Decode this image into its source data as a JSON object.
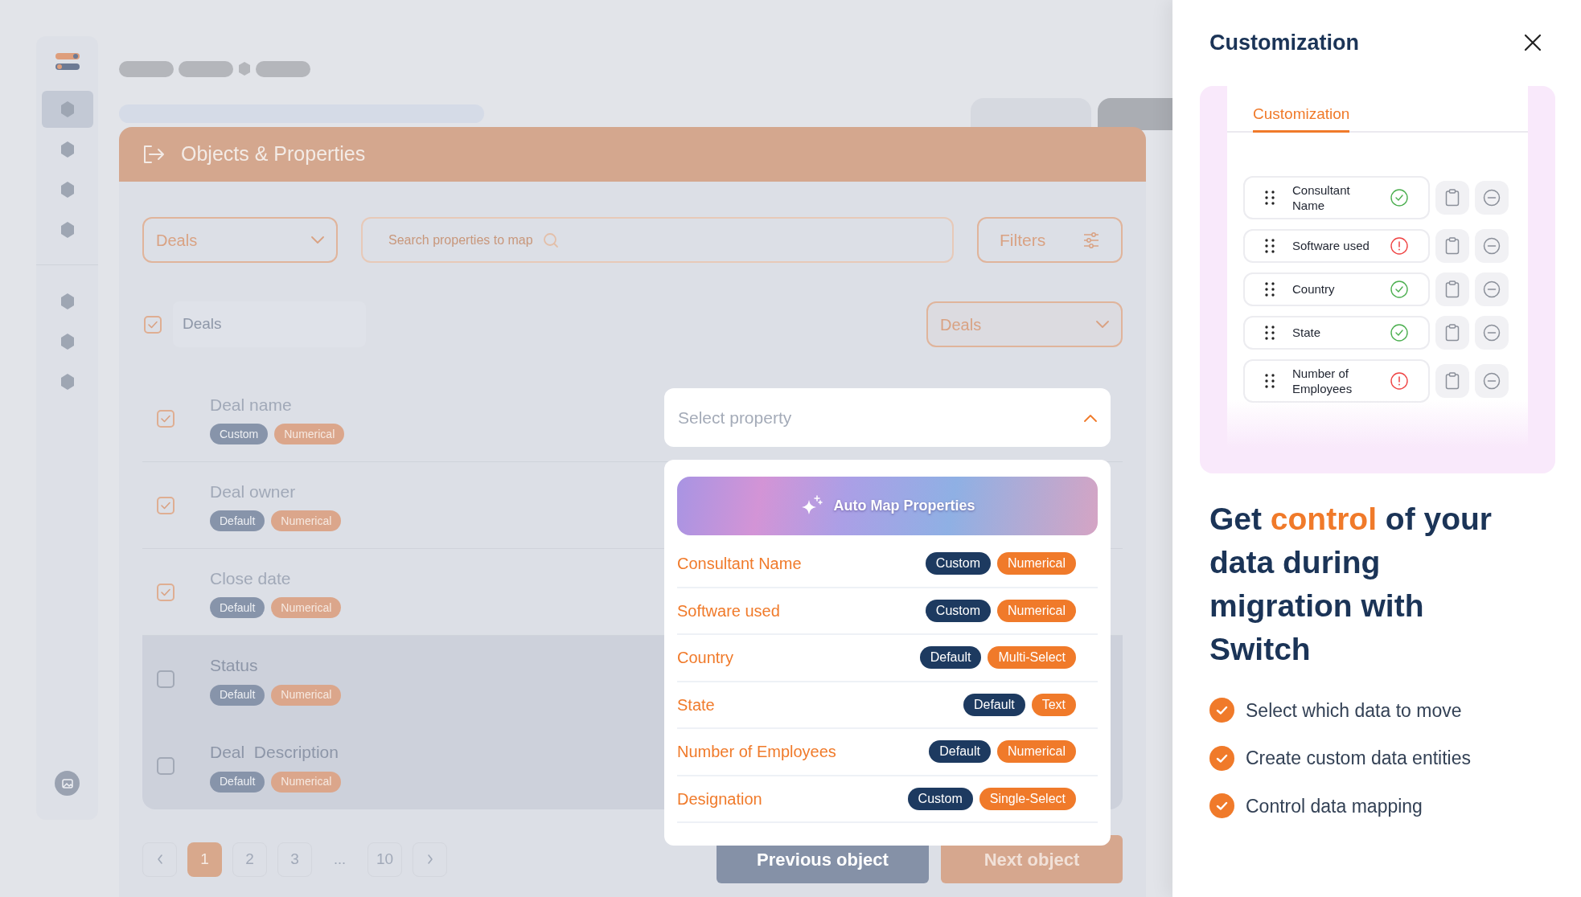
{
  "sidebar": {
    "top_items": [
      {
        "selected": true
      },
      {
        "selected": false
      },
      {
        "selected": false
      },
      {
        "selected": false
      }
    ],
    "bottom_items": [
      {
        "selected": false
      },
      {
        "selected": false
      },
      {
        "selected": false
      }
    ]
  },
  "main": {
    "title": "Objects & Properties",
    "object_select": {
      "value": "Deals"
    },
    "search": {
      "placeholder": "Search properties to map"
    },
    "filters_button": "Filters",
    "select_all": {
      "label": "Deals",
      "checked": true
    },
    "target_select": {
      "value": "Deals"
    }
  },
  "properties": [
    {
      "name": "Deal name",
      "checked": true,
      "source": "Custom",
      "type": "Numerical"
    },
    {
      "name": "Deal owner",
      "checked": true,
      "source": "Default",
      "type": "Numerical"
    },
    {
      "name": "Close date",
      "checked": true,
      "source": "Default",
      "type": "Numerical"
    },
    {
      "name": "Status",
      "checked": false,
      "source": "Default",
      "type": "Numerical"
    },
    {
      "name": "Deal  Description",
      "checked": false,
      "source": "Default",
      "type": "Numerical"
    }
  ],
  "property_dropdown": {
    "placeholder": "Select property",
    "expanded": true,
    "auto_map_button": "Auto Map Properties",
    "options": [
      {
        "name": "Consultant Name",
        "source": "Custom",
        "type": "Numerical"
      },
      {
        "name": "Software used",
        "source": "Custom",
        "type": "Numerical"
      },
      {
        "name": "Country",
        "source": "Default",
        "type": "Multi-Select"
      },
      {
        "name": "State",
        "source": "Default",
        "type": "Text"
      },
      {
        "name": "Number of Employees",
        "source": "Default",
        "type": "Numerical"
      },
      {
        "name": "Designation",
        "source": "Custom",
        "type": "Single-Select"
      }
    ]
  },
  "pagination": [
    {
      "label": "1",
      "kind": "page",
      "selected": true
    },
    {
      "label": "2",
      "kind": "page",
      "selected": false
    },
    {
      "label": "3",
      "kind": "page",
      "selected": false
    },
    {
      "label": "...",
      "kind": "ellipsis"
    },
    {
      "label": "10",
      "kind": "page",
      "selected": false
    }
  ],
  "buttons": {
    "previous": "Previous object",
    "next": "Next object"
  },
  "panel": {
    "title": "Customization",
    "tabs": [
      {
        "label": "Customization",
        "selected": true
      }
    ],
    "fields": [
      {
        "name": "Consultant Name",
        "kind": "ok"
      },
      {
        "name": "Software used",
        "kind": "error"
      },
      {
        "name": "Country",
        "kind": "ok"
      },
      {
        "name": "State",
        "kind": "ok"
      },
      {
        "name": "Number of Employees",
        "kind": "error"
      }
    ],
    "headline": [
      {
        "text": "Get ",
        "highlight": false
      },
      {
        "text": "control",
        "highlight": true
      },
      {
        "text": " of your data during migration with Switch",
        "highlight": false
      }
    ],
    "features": [
      "Select which data to move",
      "Create custom data entities",
      "Control data mapping"
    ]
  }
}
